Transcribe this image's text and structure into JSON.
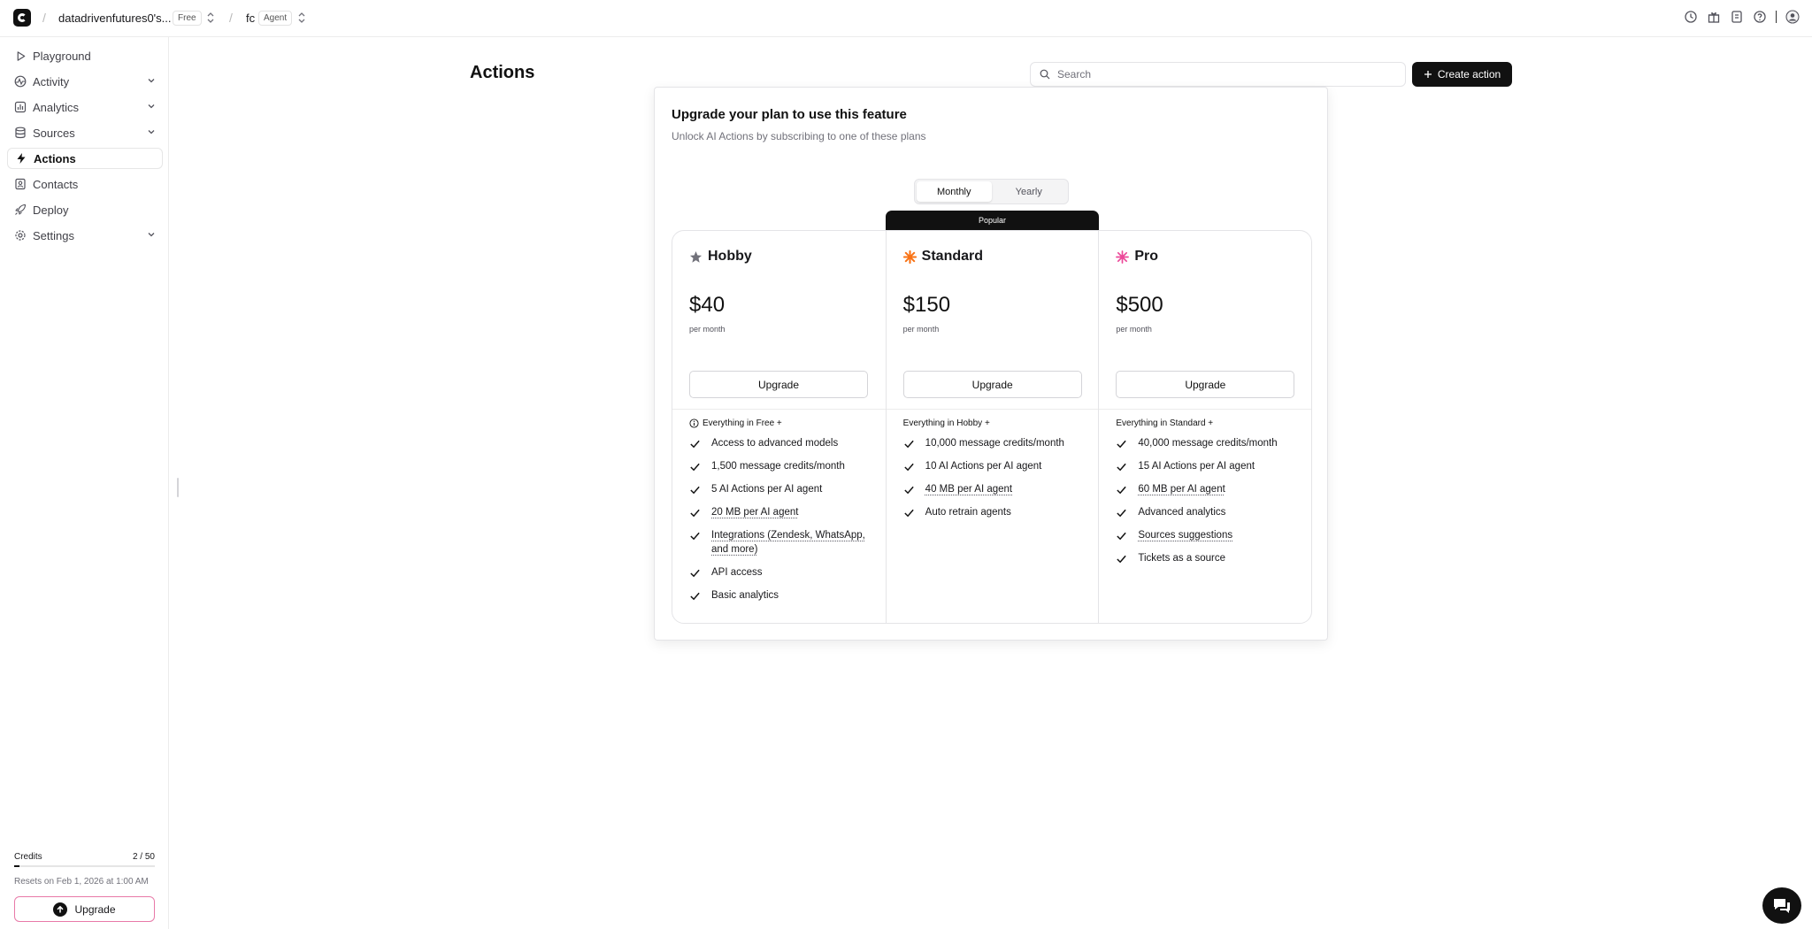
{
  "topbar": {
    "workspace": "datadrivenfutures0's...",
    "workspace_plan": "Free",
    "agent": "fc",
    "agent_badge": "Agent"
  },
  "sidebar": {
    "items": [
      {
        "label": "Playground",
        "icon": "play-icon"
      },
      {
        "label": "Activity",
        "icon": "activity-icon"
      },
      {
        "label": "Analytics",
        "icon": "chart-icon"
      },
      {
        "label": "Sources",
        "icon": "database-icon"
      },
      {
        "label": "Actions",
        "icon": "bolt-icon"
      },
      {
        "label": "Contacts",
        "icon": "contact-icon"
      },
      {
        "label": "Deploy",
        "icon": "rocket-icon"
      },
      {
        "label": "Settings",
        "icon": "gear-icon"
      }
    ],
    "active": "Actions",
    "credits_label": "Credits",
    "credits_value": "2 / 50",
    "credits_used_fraction": 0.04,
    "credits_reset": "Resets on Feb 1, 2026 at 1:00 AM",
    "upgrade_label": "Upgrade"
  },
  "main": {
    "title": "Actions",
    "search_placeholder": "Search",
    "create_label": "Create action"
  },
  "modal": {
    "title": "Upgrade your plan to use this feature",
    "subtitle": "Unlock AI Actions by subscribing to one of these plans",
    "billing": {
      "monthly": "Monthly",
      "yearly": "Yearly",
      "selected": "Monthly"
    },
    "popular_label": "Popular",
    "plans": [
      {
        "name": "Hobby",
        "icon": "star-icon",
        "icon_color": "#71717a",
        "price": "$40",
        "period": "per month",
        "button": "Upgrade",
        "includes": "Everything in Free +",
        "features": [
          "Access to advanced models",
          "1,500 message credits/month",
          "5 AI Actions per AI agent",
          "20 MB per AI agent",
          "Integrations (Zendesk, WhatsApp, and more)",
          "API access",
          "Basic analytics"
        ]
      },
      {
        "name": "Standard",
        "icon": "sparkle-icon",
        "icon_color": "#f97316",
        "price": "$150",
        "period": "per month",
        "button": "Upgrade",
        "includes": "Everything in Hobby +",
        "features": [
          "10,000 message credits/month",
          "10 AI Actions per AI agent",
          "40 MB per AI agent",
          "Auto retrain agents"
        ]
      },
      {
        "name": "Pro",
        "icon": "burst-icon",
        "icon_color": "#ec4899",
        "price": "$500",
        "period": "per month",
        "button": "Upgrade",
        "includes": "Everything in Standard +",
        "features": [
          "40,000 message credits/month",
          "15 AI Actions per AI agent",
          "60 MB per AI agent",
          "Advanced analytics",
          "Sources suggestions",
          "Tickets as a source"
        ]
      }
    ]
  }
}
